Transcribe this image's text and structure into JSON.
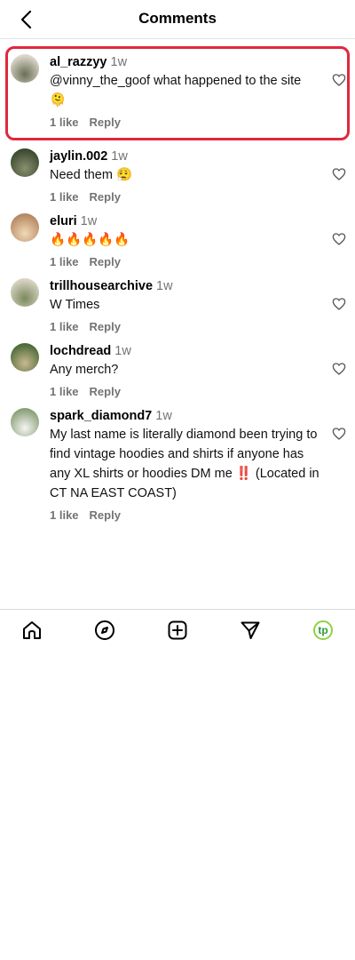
{
  "header": {
    "title": "Comments",
    "back_icon": "chevron-left-icon"
  },
  "comments": [
    {
      "username": "al_razzyy",
      "time": "1w",
      "text": "@vinny_the_goof what happened to the site 🫠",
      "likes": "1 like",
      "reply": "Reply",
      "highlighted": true,
      "avatar_colors": [
        "#dcd6cb",
        "#6a6f55"
      ]
    },
    {
      "username": "jaylin.002",
      "time": "1w",
      "text": "Need them 😮‍💨",
      "likes": "1 like",
      "reply": "Reply",
      "avatar_colors": [
        "#3b4a2f",
        "#8a8f70"
      ]
    },
    {
      "username": "eluri",
      "time": "1w",
      "text": "🔥🔥🔥🔥🔥",
      "likes": "1 like",
      "reply": "Reply",
      "avatar_colors": [
        "#b68862",
        "#f0d9b8"
      ]
    },
    {
      "username": "trillhousearchive",
      "time": "1w",
      "text": "W Times",
      "likes": "1 like",
      "reply": "Reply",
      "avatar_colors": [
        "#d9d3c4",
        "#7a8a5c"
      ]
    },
    {
      "username": "lochdread",
      "time": "1w",
      "text": "Any merch?",
      "likes": "1 like",
      "reply": "Reply",
      "avatar_colors": [
        "#4f6b3a",
        "#c9b98f"
      ]
    },
    {
      "username": "spark_diamond7",
      "time": "1w",
      "text": "My last name is literally diamond been trying to find vintage hoodies and shirts if anyone has any XL shirts or hoodies DM me ‼️ (Located in CT NA EAST COAST)",
      "likes": "1 like",
      "reply": "Reply",
      "avatar_colors": [
        "#8aa07a",
        "#f5f5f0"
      ]
    }
  ],
  "bottom_nav": {
    "items": [
      "home-icon",
      "explore-icon",
      "create-icon",
      "direct-message-icon",
      "profile-icon"
    ],
    "profile_initials": "tp",
    "profile_color": "#8ed343"
  },
  "colors": {
    "highlight_border": "#e0283c",
    "meta_text": "#737373"
  }
}
